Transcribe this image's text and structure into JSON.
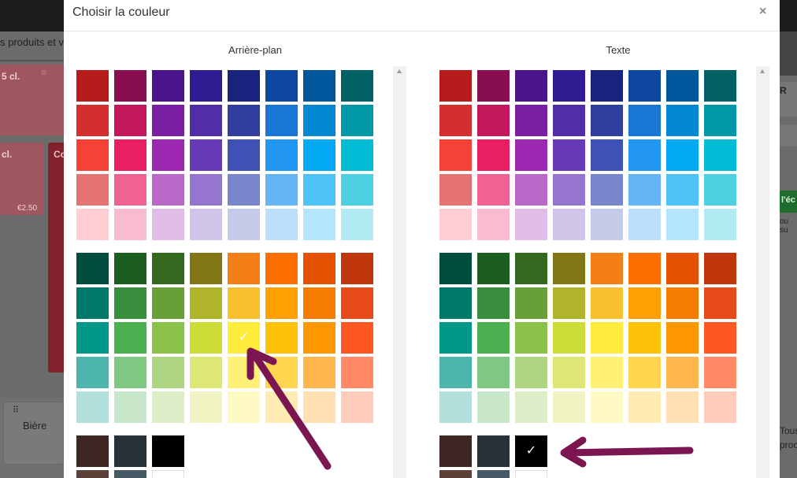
{
  "background": {
    "crumb": "s produits et v",
    "card1": {
      "label": "5 cl.",
      "menu": "≡"
    },
    "card2": {
      "label": "cl.",
      "price": "€2.50"
    },
    "card3": {
      "label": "Co"
    },
    "tile": {
      "label": "Bière",
      "icon": "⠿"
    },
    "right": {
      "r_label": "R",
      "r_sub": "pe",
      "green_label": "l'éc",
      "vous": "ou su",
      "tous": "Tous",
      "proc": "proc"
    }
  },
  "modal": {
    "title": "Choisir la couleur",
    "close": "×",
    "panels": [
      {
        "id": "background",
        "title": "Arrière-plan",
        "selected": "yellow-400"
      },
      {
        "id": "text",
        "title": "Texte",
        "selected": "black"
      }
    ]
  },
  "palette": {
    "group1": [
      [
        "#b71c1c",
        "#880e4f",
        "#4a148c",
        "#311b92",
        "#1a237e",
        "#0d47a1",
        "#01579b",
        "#006064"
      ],
      [
        "#d32f2f",
        "#c2185b",
        "#7b1fa2",
        "#512da8",
        "#303f9f",
        "#1976d2",
        "#0288d1",
        "#0097a7"
      ],
      [
        "#f44336",
        "#e91e63",
        "#9c27b0",
        "#673ab7",
        "#3f51b5",
        "#2196f3",
        "#03a9f4",
        "#00bcd4"
      ],
      [
        "#e57373",
        "#f06292",
        "#ba68c8",
        "#9575cd",
        "#7986cb",
        "#64b5f6",
        "#4fc3f7",
        "#4dd0e1"
      ],
      [
        "#ffcdd2",
        "#f8bbd0",
        "#e1bee7",
        "#d1c4e9",
        "#c5cae9",
        "#bbdefb",
        "#b3e5fc",
        "#b2ebf2"
      ]
    ],
    "group2": [
      [
        "#004d40",
        "#1b5e20",
        "#33691e",
        "#827717",
        "#f57f17",
        "#ff6f00",
        "#e65100",
        "#bf360c"
      ],
      [
        "#00796b",
        "#388e3c",
        "#689f38",
        "#afb42b",
        "#fbc02d",
        "#ffa000",
        "#f57c00",
        "#e64a19"
      ],
      [
        "#009688",
        "#4caf50",
        "#8bc34a",
        "#cddc39",
        "#ffeb3b",
        "#ffc107",
        "#ff9800",
        "#ff5722"
      ],
      [
        "#4db6ac",
        "#81c784",
        "#aed581",
        "#dce775",
        "#fff176",
        "#ffd54f",
        "#ffb74d",
        "#ff8a65"
      ],
      [
        "#b2dfdb",
        "#c8e6c9",
        "#dcedc8",
        "#f0f4c3",
        "#fff9c4",
        "#ffecb3",
        "#ffe0b2",
        "#ffccbc"
      ]
    ],
    "group3": [
      [
        "#3e2723",
        "#263238",
        "#000000"
      ],
      [
        "#5d4037",
        "#455a64",
        "#ffffff"
      ]
    ],
    "check_icon": "✓",
    "arrow_color": "#7b1650"
  }
}
